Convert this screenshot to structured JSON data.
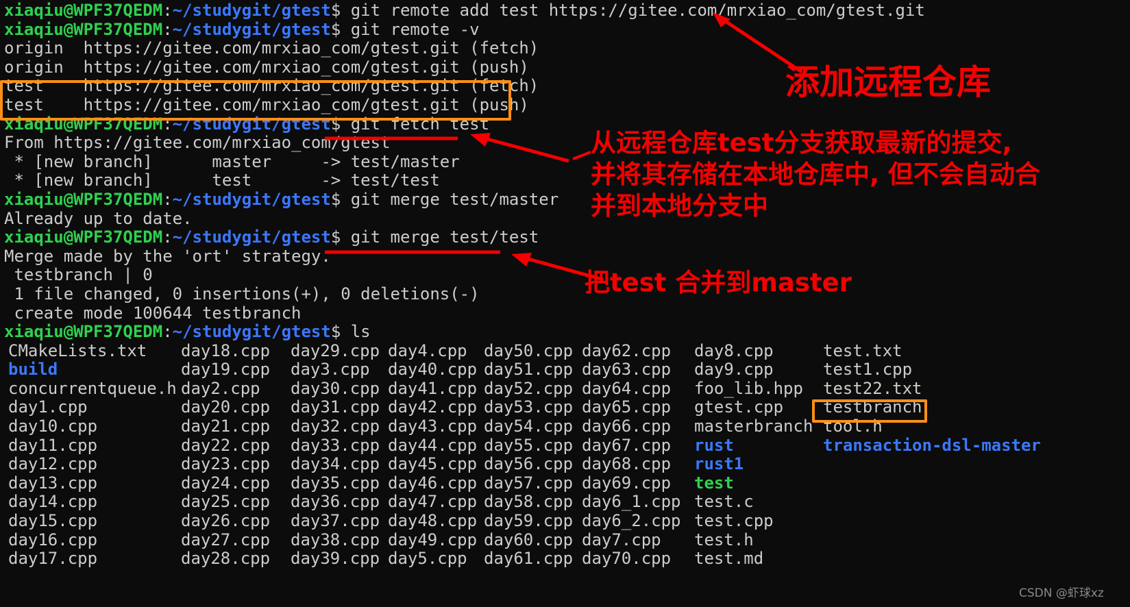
{
  "terminal": {
    "background": "#0c0c0c",
    "foreground": "#cccccc",
    "prompt": {
      "user_host": "xiaqiu@WPF37QEDM",
      "colon": ":",
      "path": "~/studygit/gtest",
      "dollar": "$",
      "user_color": "#2fd14f",
      "path_color": "#3b78ff"
    },
    "lines": [
      {
        "type": "prompt",
        "command": " git remote add test https://gitee.com/mrxiao_com/gtest.git"
      },
      {
        "type": "prompt",
        "command": " git remote -v"
      },
      {
        "type": "output",
        "text": "origin  https://gitee.com/mrxiao_com/gtest.git (fetch)"
      },
      {
        "type": "output",
        "text": "origin  https://gitee.com/mrxiao_com/gtest.git (push)"
      },
      {
        "type": "output",
        "text": "test    https://gitee.com/mrxiao_com/gtest.git (fetch)"
      },
      {
        "type": "output",
        "text": "test    https://gitee.com/mrxiao_com/gtest.git (push)"
      },
      {
        "type": "prompt",
        "command": " git fetch test"
      },
      {
        "type": "output",
        "text": "From https://gitee.com/mrxiao_com/gtest"
      },
      {
        "type": "output",
        "text": " * [new branch]      master     -> test/master"
      },
      {
        "type": "output",
        "text": " * [new branch]      test       -> test/test"
      },
      {
        "type": "prompt",
        "command": " git merge test/master"
      },
      {
        "type": "output",
        "text": "Already up to date."
      },
      {
        "type": "prompt",
        "command": " git merge test/test"
      },
      {
        "type": "output",
        "text": "Merge made by the 'ort' strategy."
      },
      {
        "type": "output",
        "text": " testbranch | 0"
      },
      {
        "type": "output",
        "text": " 1 file changed, 0 insertions(+), 0 deletions(-)"
      },
      {
        "type": "output",
        "text": " create mode 100644 testbranch"
      },
      {
        "type": "prompt",
        "command": " ls"
      }
    ]
  },
  "ls_listing": {
    "column_x": [
      6,
      258,
      418,
      560,
      700,
      843,
      1007,
      1195
    ],
    "rows": [
      [
        {
          "name": "CMakeLists.txt",
          "kind": "file"
        },
        {
          "name": "day18.cpp",
          "kind": "file"
        },
        {
          "name": "day29.cpp",
          "kind": "file"
        },
        {
          "name": "day4.cpp",
          "kind": "file"
        },
        {
          "name": "day50.cpp",
          "kind": "file"
        },
        {
          "name": "day62.cpp",
          "kind": "file"
        },
        {
          "name": "day8.cpp",
          "kind": "file"
        },
        {
          "name": "test.txt",
          "kind": "file"
        }
      ],
      [
        {
          "name": "build",
          "kind": "dir"
        },
        {
          "name": "day19.cpp",
          "kind": "file"
        },
        {
          "name": "day3.cpp",
          "kind": "file"
        },
        {
          "name": "day40.cpp",
          "kind": "file"
        },
        {
          "name": "day51.cpp",
          "kind": "file"
        },
        {
          "name": "day63.cpp",
          "kind": "file"
        },
        {
          "name": "day9.cpp",
          "kind": "file"
        },
        {
          "name": "test1.cpp",
          "kind": "file"
        }
      ],
      [
        {
          "name": "concurrentqueue.h",
          "kind": "file"
        },
        {
          "name": "day2.cpp",
          "kind": "file"
        },
        {
          "name": "day30.cpp",
          "kind": "file"
        },
        {
          "name": "day41.cpp",
          "kind": "file"
        },
        {
          "name": "day52.cpp",
          "kind": "file"
        },
        {
          "name": "day64.cpp",
          "kind": "file"
        },
        {
          "name": "foo_lib.hpp",
          "kind": "file"
        },
        {
          "name": "test22.txt",
          "kind": "file"
        }
      ],
      [
        {
          "name": "day1.cpp",
          "kind": "file"
        },
        {
          "name": "day20.cpp",
          "kind": "file"
        },
        {
          "name": "day31.cpp",
          "kind": "file"
        },
        {
          "name": "day42.cpp",
          "kind": "file"
        },
        {
          "name": "day53.cpp",
          "kind": "file"
        },
        {
          "name": "day65.cpp",
          "kind": "file"
        },
        {
          "name": "gtest.cpp",
          "kind": "file"
        },
        {
          "name": "testbranch",
          "kind": "file"
        }
      ],
      [
        {
          "name": "day10.cpp",
          "kind": "file"
        },
        {
          "name": "day21.cpp",
          "kind": "file"
        },
        {
          "name": "day32.cpp",
          "kind": "file"
        },
        {
          "name": "day43.cpp",
          "kind": "file"
        },
        {
          "name": "day54.cpp",
          "kind": "file"
        },
        {
          "name": "day66.cpp",
          "kind": "file"
        },
        {
          "name": "masterbranch",
          "kind": "file"
        },
        {
          "name": "tool.h",
          "kind": "file"
        }
      ],
      [
        {
          "name": "day11.cpp",
          "kind": "file"
        },
        {
          "name": "day22.cpp",
          "kind": "file"
        },
        {
          "name": "day33.cpp",
          "kind": "file"
        },
        {
          "name": "day44.cpp",
          "kind": "file"
        },
        {
          "name": "day55.cpp",
          "kind": "file"
        },
        {
          "name": "day67.cpp",
          "kind": "file"
        },
        {
          "name": "rust",
          "kind": "dir"
        },
        {
          "name": "transaction-dsl-master",
          "kind": "dir"
        }
      ],
      [
        {
          "name": "day12.cpp",
          "kind": "file"
        },
        {
          "name": "day23.cpp",
          "kind": "file"
        },
        {
          "name": "day34.cpp",
          "kind": "file"
        },
        {
          "name": "day45.cpp",
          "kind": "file"
        },
        {
          "name": "day56.cpp",
          "kind": "file"
        },
        {
          "name": "day68.cpp",
          "kind": "file"
        },
        {
          "name": "rust1",
          "kind": "dir"
        },
        {
          "name": "",
          "kind": "file"
        }
      ],
      [
        {
          "name": "day13.cpp",
          "kind": "file"
        },
        {
          "name": "day24.cpp",
          "kind": "file"
        },
        {
          "name": "day35.cpp",
          "kind": "file"
        },
        {
          "name": "day46.cpp",
          "kind": "file"
        },
        {
          "name": "day57.cpp",
          "kind": "file"
        },
        {
          "name": "day69.cpp",
          "kind": "file"
        },
        {
          "name": "test",
          "kind": "exe"
        },
        {
          "name": "",
          "kind": "file"
        }
      ],
      [
        {
          "name": "day14.cpp",
          "kind": "file"
        },
        {
          "name": "day25.cpp",
          "kind": "file"
        },
        {
          "name": "day36.cpp",
          "kind": "file"
        },
        {
          "name": "day47.cpp",
          "kind": "file"
        },
        {
          "name": "day58.cpp",
          "kind": "file"
        },
        {
          "name": "day6_1.cpp",
          "kind": "file"
        },
        {
          "name": "test.c",
          "kind": "file"
        },
        {
          "name": "",
          "kind": "file"
        }
      ],
      [
        {
          "name": "day15.cpp",
          "kind": "file"
        },
        {
          "name": "day26.cpp",
          "kind": "file"
        },
        {
          "name": "day37.cpp",
          "kind": "file"
        },
        {
          "name": "day48.cpp",
          "kind": "file"
        },
        {
          "name": "day59.cpp",
          "kind": "file"
        },
        {
          "name": "day6_2.cpp",
          "kind": "file"
        },
        {
          "name": "test.cpp",
          "kind": "file"
        },
        {
          "name": "",
          "kind": "file"
        }
      ],
      [
        {
          "name": "day16.cpp",
          "kind": "file"
        },
        {
          "name": "day27.cpp",
          "kind": "file"
        },
        {
          "name": "day38.cpp",
          "kind": "file"
        },
        {
          "name": "day49.cpp",
          "kind": "file"
        },
        {
          "name": "day60.cpp",
          "kind": "file"
        },
        {
          "name": "day7.cpp",
          "kind": "file"
        },
        {
          "name": "test.h",
          "kind": "file"
        },
        {
          "name": "",
          "kind": "file"
        }
      ],
      [
        {
          "name": "day17.cpp",
          "kind": "file"
        },
        {
          "name": "day28.cpp",
          "kind": "file"
        },
        {
          "name": "day39.cpp",
          "kind": "file"
        },
        {
          "name": "day5.cpp",
          "kind": "file"
        },
        {
          "name": "day61.cpp",
          "kind": "file"
        },
        {
          "name": "day70.cpp",
          "kind": "file"
        },
        {
          "name": "test.md",
          "kind": "file"
        },
        {
          "name": "",
          "kind": "file"
        }
      ]
    ]
  },
  "annotations": {
    "highlight_color": "#ff9017",
    "marker_color": "#f50000",
    "note_add_remote": "添加远程仓库",
    "note_fetch_line1": "从远程仓库test分支获取最新的提交,",
    "note_fetch_line2": "并将其存储在本地仓库中, 但不会自动合",
    "note_fetch_line3": "并到本地分支中",
    "note_merge": "把test 合并到master"
  },
  "watermark": {
    "text": "CSDN @虾球xz"
  }
}
